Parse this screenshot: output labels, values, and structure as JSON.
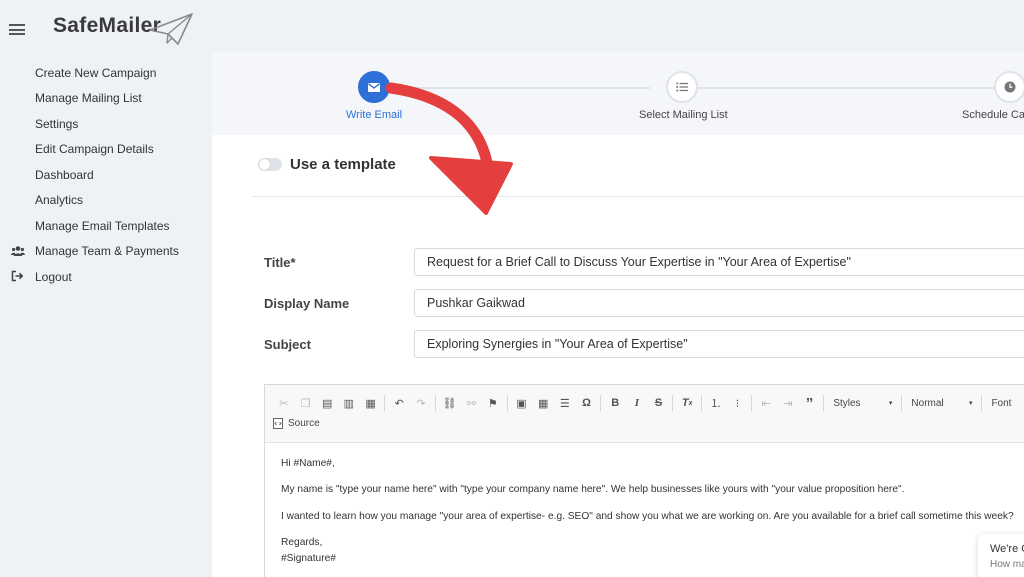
{
  "app": {
    "logo": "SafeMailer"
  },
  "sidebar": {
    "items": [
      {
        "label": "Create New Campaign"
      },
      {
        "label": "Manage Mailing List"
      },
      {
        "label": "Settings"
      },
      {
        "label": "Edit Campaign Details"
      },
      {
        "label": "Dashboard"
      },
      {
        "label": "Analytics"
      },
      {
        "label": "Manage Email Templates"
      },
      {
        "label": "Manage Team & Payments",
        "icon": "users-icon"
      },
      {
        "label": "Logout",
        "icon": "sign-out-icon"
      }
    ]
  },
  "stepper": {
    "steps": [
      {
        "label": "Write Email",
        "icon": "envelope-icon",
        "active": true
      },
      {
        "label": "Select Mailing List",
        "icon": "list-icon",
        "active": false
      },
      {
        "label": "Schedule Ca",
        "icon": "clock-icon",
        "active": false
      }
    ]
  },
  "template_toggle": {
    "label": "Use a template",
    "on": false
  },
  "form": {
    "title_label": "Title*",
    "title_value": "Request for a Brief Call to Discuss Your Expertise in \"Your Area of Expertise\"",
    "display_name_label": "Display Name",
    "display_name_value": "Pushkar Gaikwad",
    "subject_label": "Subject",
    "subject_value": "Exploring Synergies in \"Your Area of Expertise\""
  },
  "editor": {
    "styles_combo": "Styles",
    "format_combo": "Normal",
    "font_combo": "Font",
    "source_label": "Source",
    "body": {
      "greeting": "Hi #Name#,",
      "para1": "My name is \"type your name here\" with \"type your company name here\". We help businesses like yours with \"your value proposition here\".",
      "para2": "I wanted to learn how you manage \"your area of expertise- e.g. SEO\" and show you what we are working on. Are you available for a brief call sometime this week?",
      "closing": "Regards,",
      "signature": "#Signature#"
    }
  },
  "chat": {
    "title": "We're O",
    "subtitle": "How ma"
  },
  "colors": {
    "accent": "#2f6fd8",
    "arrow": "#e53e3e",
    "background": "#eef1f6"
  }
}
